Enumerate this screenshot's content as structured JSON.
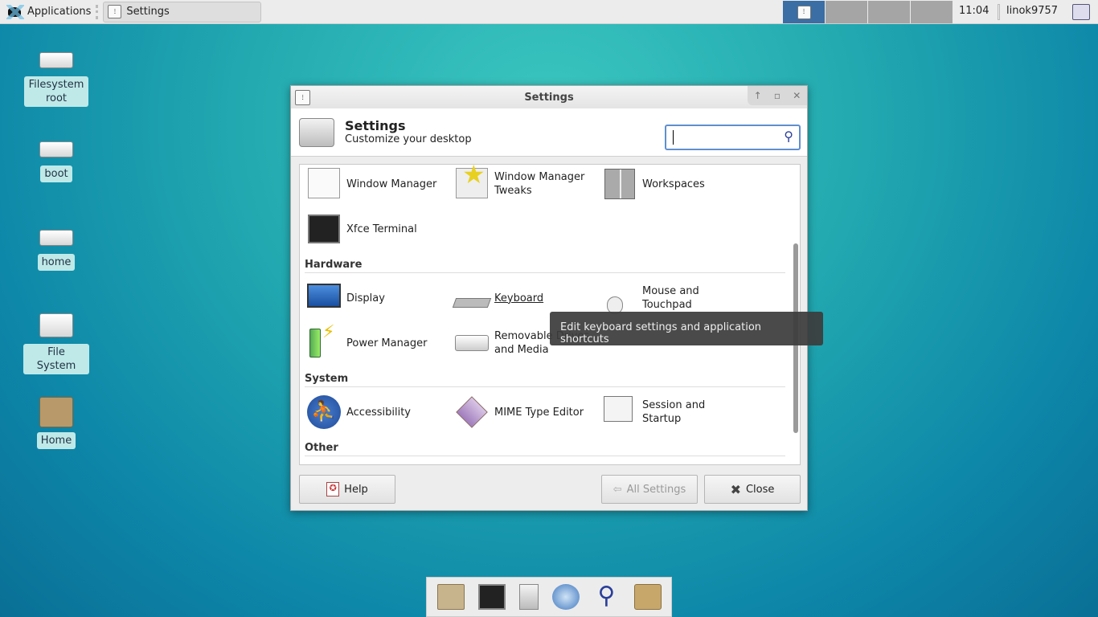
{
  "panel": {
    "applications_label": "Applications",
    "task_label": "Settings",
    "clock": "11:04",
    "user": "linok9757",
    "workspace_active": 1,
    "workspace_count": 4
  },
  "desktop": {
    "icons": [
      {
        "label": "Filesystem root",
        "icon": "drive-icon"
      },
      {
        "label": "boot",
        "icon": "drive-icon"
      },
      {
        "label": "home",
        "icon": "drive-icon"
      },
      {
        "label": "File System",
        "icon": "harddisk-icon"
      },
      {
        "label": "Home",
        "icon": "home-folder-icon"
      }
    ]
  },
  "window": {
    "title": "Settings",
    "header_title": "Settings",
    "header_subtitle": "Customize your desktop",
    "search_value": "",
    "controls": [
      "roll-up",
      "maximize",
      "close"
    ],
    "items_top": [
      {
        "label": "Window Manager"
      },
      {
        "label": "Window Manager Tweaks"
      },
      {
        "label": "Workspaces"
      },
      {
        "label": "Xfce Terminal"
      }
    ],
    "sections": [
      {
        "title": "Hardware",
        "items": [
          {
            "label": "Display"
          },
          {
            "label": "Keyboard"
          },
          {
            "label": "Mouse and Touchpad"
          },
          {
            "label": "Power Manager"
          },
          {
            "label": "Removable Drives and Media"
          }
        ]
      },
      {
        "title": "System",
        "items": [
          {
            "label": "Accessibility"
          },
          {
            "label": "MIME Type Editor"
          },
          {
            "label": "Session and Startup"
          }
        ]
      },
      {
        "title": "Other",
        "items": []
      }
    ],
    "buttons": {
      "help": "Help",
      "all_settings": "All Settings",
      "close": "Close"
    },
    "tooltip": "Edit keyboard settings and application shortcuts"
  },
  "dock": {
    "items": [
      "file-manager-icon",
      "terminal-icon",
      "filing-cabinet-icon",
      "web-browser-icon",
      "search-icon",
      "folder-icon"
    ]
  }
}
